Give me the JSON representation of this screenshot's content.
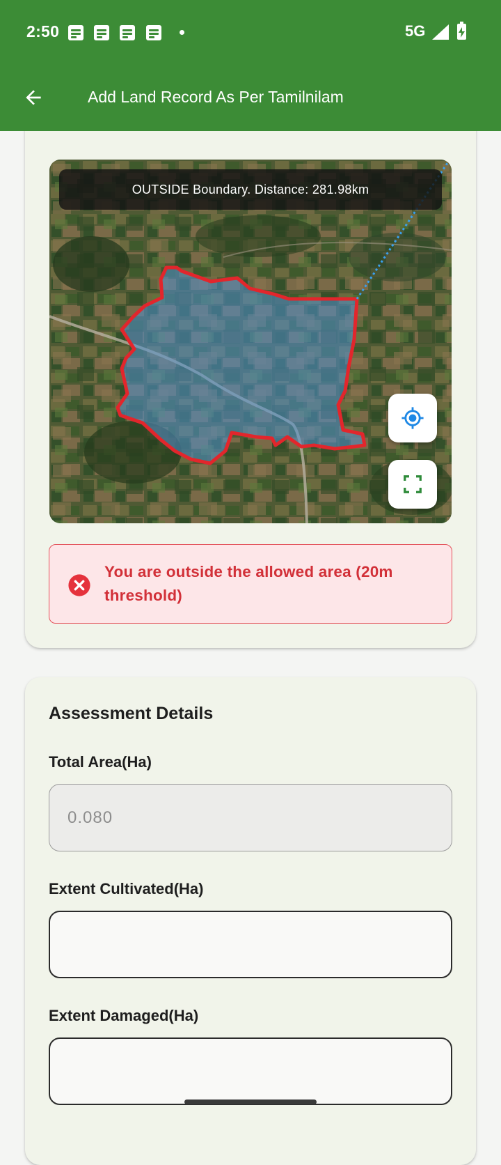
{
  "status_bar": {
    "time": "2:50",
    "notification_icons": [
      "note-icon",
      "note-icon",
      "note-icon",
      "note-icon"
    ],
    "network": "5G",
    "signal_icon": "signal-icon",
    "battery_icon": "battery-charging-icon"
  },
  "app_bar": {
    "title": "Add Land Record As Per Tamilnilam",
    "back_icon": "arrow-back-icon"
  },
  "map": {
    "banner": "OUTSIDE Boundary. Distance: 281.98km",
    "locate_icon": "my-location-icon",
    "fullscreen_icon": "fullscreen-icon",
    "boundary_color": "#e2262c"
  },
  "alert": {
    "message": "You are outside the allowed area (20m threshold)",
    "icon": "error-circle-icon",
    "color": "#d23038"
  },
  "assessment": {
    "title": "Assessment Details",
    "fields": [
      {
        "label": "Total Area(Ha)",
        "value": "0.080",
        "disabled": true
      },
      {
        "label": "Extent Cultivated(Ha)",
        "value": ""
      },
      {
        "label": "Extent Damaged(Ha)",
        "value": ""
      }
    ]
  },
  "colors": {
    "primary": "#3c8c36",
    "card_bg": "#f1f4ea",
    "error": "#d23038"
  }
}
